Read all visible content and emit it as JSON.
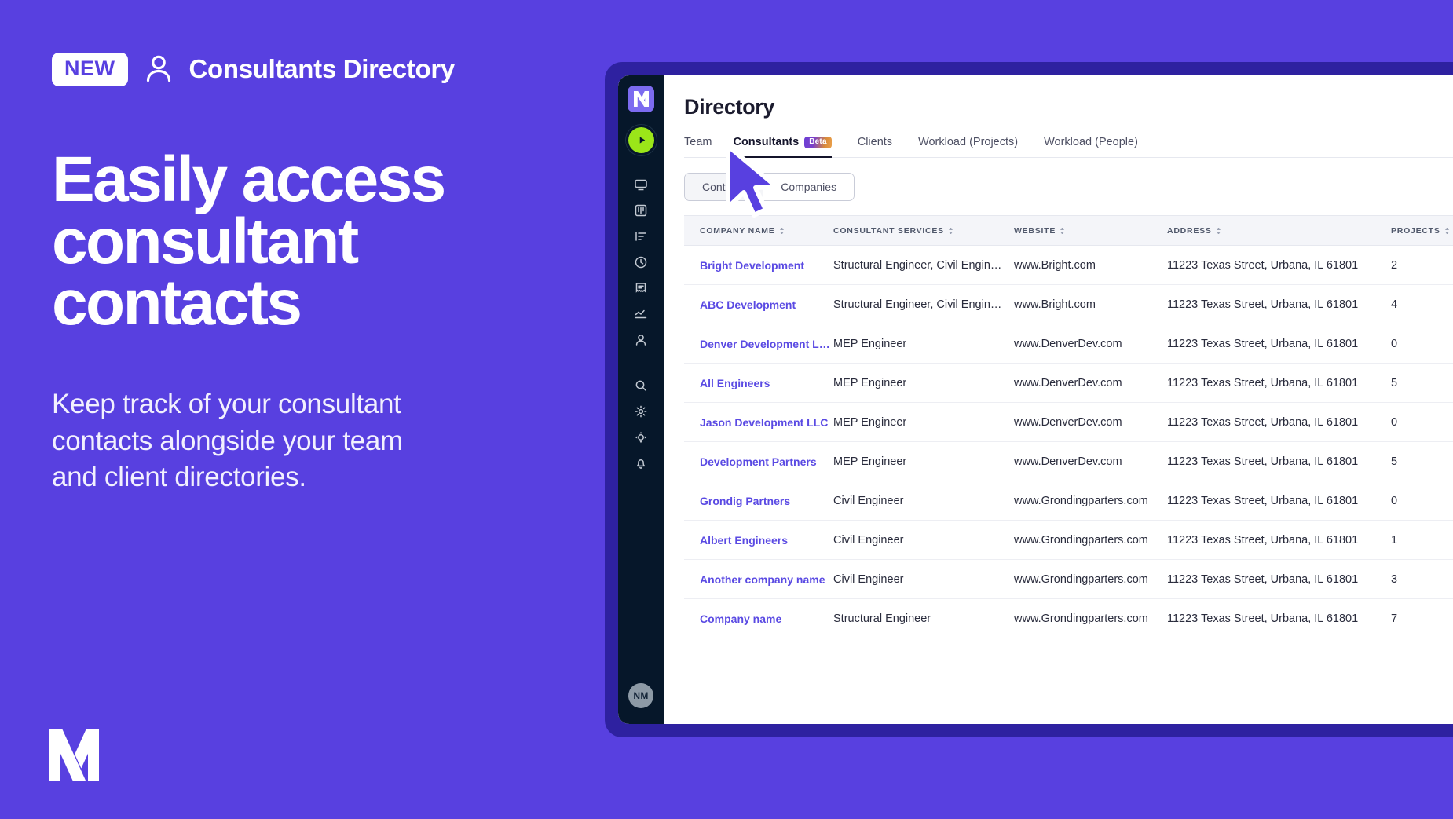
{
  "marketing": {
    "badge": "NEW",
    "eyebrow_icon": "person-icon",
    "eyebrow_title": "Consultants Directory",
    "headline": "Easily access consultant contacts",
    "subcopy": "Keep track of your consultant contacts alongside your team and client directories.",
    "brand_logo": "monograph-logo",
    "background_color": "#5840E0",
    "badge_text_color": "#5840E0"
  },
  "app": {
    "frame_color": "#2E21A0",
    "sidebar": {
      "background": "#06172A",
      "logo": "monograph-logo-tile",
      "play_button": "play-icon",
      "play_color": "#9BE619",
      "items": [
        {
          "icon": "monitor-icon"
        },
        {
          "icon": "kanban-board-icon"
        },
        {
          "icon": "task-list-icon"
        },
        {
          "icon": "clock-icon"
        },
        {
          "icon": "invoice-icon"
        },
        {
          "icon": "chart-line-icon"
        },
        {
          "icon": "person-icon"
        },
        {
          "icon": "search-icon"
        },
        {
          "icon": "gear-icon"
        },
        {
          "icon": "compass-icon"
        },
        {
          "icon": "bell-icon"
        }
      ],
      "avatar_initials": "NM"
    },
    "page_title": "Directory",
    "tabs": [
      {
        "label": "Team",
        "active": false,
        "badge": null
      },
      {
        "label": "Consultants",
        "active": true,
        "badge": "Beta"
      },
      {
        "label": "Clients",
        "active": false,
        "badge": null
      },
      {
        "label": "Workload (Projects)",
        "active": false,
        "badge": null
      },
      {
        "label": "Workload (People)",
        "active": false,
        "badge": null
      }
    ],
    "segmented_control": {
      "options": [
        "Contacts",
        "Companies"
      ],
      "selected": "Contacts"
    },
    "table": {
      "columns": [
        {
          "label": "COMPANY NAME",
          "sortable": true
        },
        {
          "label": "CONSULTANT SERVICES",
          "sortable": true
        },
        {
          "label": "WEBSITE",
          "sortable": true
        },
        {
          "label": "ADDRESS",
          "sortable": true
        },
        {
          "label": "PROJECTS",
          "sortable": true
        }
      ],
      "rows": [
        {
          "company": "Bright Development",
          "services": "Structural Engineer, Civil Engin…",
          "website": "www.Bright.com",
          "address": "11223 Texas Street, Urbana, IL 61801",
          "projects": "2"
        },
        {
          "company": "ABC Development",
          "services": "Structural Engineer, Civil Engin…",
          "website": "www.Bright.com",
          "address": "11223 Texas Street, Urbana, IL 61801",
          "projects": "4"
        },
        {
          "company": "Denver Development LLC",
          "services": "MEP Engineer",
          "website": "www.DenverDev.com",
          "address": "11223 Texas Street, Urbana, IL 61801",
          "projects": "0"
        },
        {
          "company": "All Engineers",
          "services": "MEP Engineer",
          "website": "www.DenverDev.com",
          "address": "11223 Texas Street, Urbana, IL 61801",
          "projects": "5"
        },
        {
          "company": "Jason Development LLC",
          "services": "MEP Engineer",
          "website": "www.DenverDev.com",
          "address": "11223 Texas Street, Urbana, IL 61801",
          "projects": "0"
        },
        {
          "company": "Development Partners",
          "services": "MEP Engineer",
          "website": "www.DenverDev.com",
          "address": "11223 Texas Street, Urbana, IL 61801",
          "projects": "5"
        },
        {
          "company": "Grondig Partners",
          "services": "Civil Engineer",
          "website": "www.Grondingparters.com",
          "address": "11223 Texas Street, Urbana, IL 61801",
          "projects": "0"
        },
        {
          "company": "Albert Engineers",
          "services": "Civil Engineer",
          "website": "www.Grondingparters.com",
          "address": "11223 Texas Street, Urbana, IL 61801",
          "projects": "1"
        },
        {
          "company": "Another company name",
          "services": "Civil Engineer",
          "website": "www.Grondingparters.com",
          "address": "11223 Texas Street, Urbana, IL 61801",
          "projects": "3"
        },
        {
          "company": "Company name",
          "services": "Structural Engineer",
          "website": "www.Grondingparters.com",
          "address": "11223 Texas Street, Urbana, IL 61801",
          "projects": "7"
        }
      ]
    },
    "cursor": {
      "icon": "mouse-pointer-icon",
      "color": "#5840E0"
    },
    "link_color": "#5A4AE3"
  }
}
